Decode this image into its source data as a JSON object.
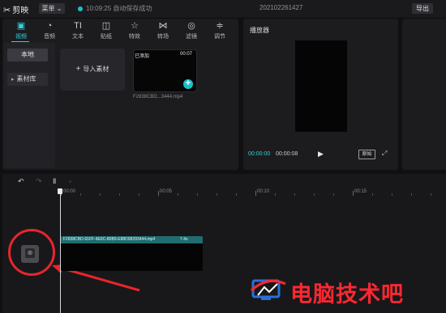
{
  "topbar": {
    "app_name": "剪映",
    "menu_label": "菜单",
    "autosave_text": "10:09:25 自动保存成功",
    "project_title": "202102261427",
    "export_label": "导出"
  },
  "media_tabs": [
    {
      "label": "视频",
      "icon": "video-icon",
      "glyph": "▣",
      "active": true
    },
    {
      "label": "音频",
      "icon": "audio-icon",
      "glyph": "◔"
    },
    {
      "label": "文本",
      "icon": "text-icon",
      "glyph": "TI"
    },
    {
      "label": "贴纸",
      "icon": "sticker-icon",
      "glyph": "◫"
    },
    {
      "label": "特效",
      "icon": "effects-icon",
      "glyph": "☆"
    },
    {
      "label": "转场",
      "icon": "transition-icon",
      "glyph": "⋈"
    },
    {
      "label": "滤镜",
      "icon": "filter-icon",
      "glyph": "◎"
    },
    {
      "label": "调节",
      "icon": "adjust-icon",
      "glyph": "≑"
    }
  ],
  "media_side": {
    "local_label": "本地",
    "library_label": "素材库"
  },
  "media_content": {
    "import_label": "导入素材",
    "clip_badge": "已添加",
    "clip_duration": "00:07",
    "clip_filename": "F2838CBD...3444.mp4"
  },
  "player": {
    "title": "播放器",
    "current_time": "00:00:00",
    "total_time": "00:00:08",
    "ratio_label": "原始"
  },
  "timeline": {
    "ruler_labels": [
      "00:00",
      "00:05",
      "00:10",
      "00:15"
    ],
    "clip_label": "F2838CBD-91FF-4E6C-80B9-E88D08293444.mp4",
    "clip_length": "7.4s"
  },
  "watermark": {
    "text": "电脑技术吧"
  },
  "colors": {
    "accent": "#2fd4d9",
    "highlight_red": "#e8252b",
    "watermark_red": "#ff2730"
  }
}
